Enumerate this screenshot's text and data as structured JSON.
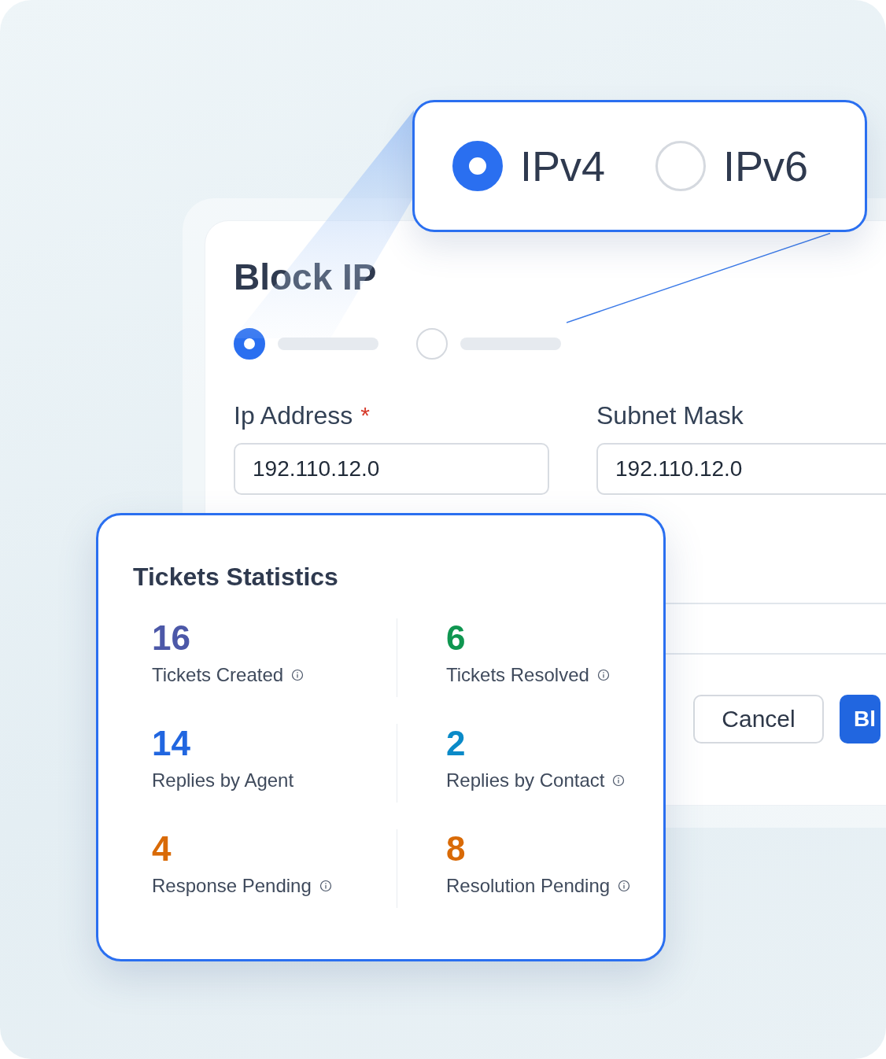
{
  "zoom_popover": {
    "options": [
      {
        "label": "IPv4",
        "selected": true
      },
      {
        "label": "IPv6",
        "selected": false
      }
    ]
  },
  "form": {
    "title": "Block IP",
    "steps": [
      {
        "selected": true
      },
      {
        "selected": false
      }
    ],
    "fields": [
      {
        "label": "Ip Address",
        "required_mark": "*",
        "value": "192.110.12.0"
      },
      {
        "label": "Subnet Mask",
        "value": "192.110.12.0"
      }
    ],
    "buttons": [
      {
        "label": "Cancel",
        "kind": "secondary"
      },
      {
        "label": "Bl",
        "kind": "primary"
      }
    ]
  },
  "stats": {
    "title": "Tickets Statistics",
    "items": [
      {
        "value": "16",
        "label": "Tickets Created",
        "color": "#4c58a8",
        "info": true
      },
      {
        "value": "6",
        "label": "Tickets Resolved",
        "color": "#0f9650",
        "info": true
      },
      {
        "value": "14",
        "label": "Replies by Agent",
        "color": "#2166e0",
        "info": false
      },
      {
        "value": "2",
        "label": "Replies by Contact",
        "color": "#0a8ac8",
        "info": true
      },
      {
        "value": "4",
        "label": "Response Pending",
        "color": "#d96a06",
        "info": true
      },
      {
        "value": "8",
        "label": "Resolution Pending",
        "color": "#d96a06",
        "info": true
      }
    ]
  }
}
